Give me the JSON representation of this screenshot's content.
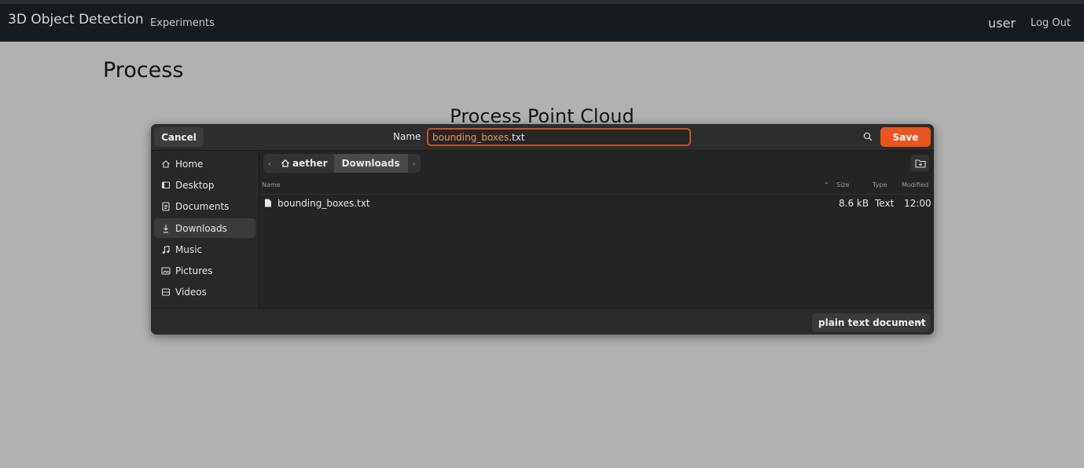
{
  "app": {
    "brand": "3D Object Detection",
    "nav_links": [
      "Experiments"
    ],
    "user": "user",
    "logout": "Log Out"
  },
  "page": {
    "title": "Process",
    "section_title": "Process Point Cloud"
  },
  "dialog": {
    "cancel_label": "Cancel",
    "name_label": "Name",
    "filename_stem": "bounding_boxes",
    "filename_ext": ".txt",
    "save_label": "Save",
    "sidebar": [
      {
        "label": "Home",
        "icon": "home-icon",
        "active": false
      },
      {
        "label": "Desktop",
        "icon": "desktop-icon",
        "active": false
      },
      {
        "label": "Documents",
        "icon": "document-icon",
        "active": false
      },
      {
        "label": "Downloads",
        "icon": "download-icon",
        "active": true
      },
      {
        "label": "Music",
        "icon": "music-icon",
        "active": false
      },
      {
        "label": "Pictures",
        "icon": "pictures-icon",
        "active": false
      },
      {
        "label": "Videos",
        "icon": "videos-icon",
        "active": false
      }
    ],
    "path": [
      "aether",
      "Downloads"
    ],
    "columns": {
      "name": "Name",
      "size": "Size",
      "type": "Type",
      "modified": "Modified"
    },
    "files": [
      {
        "name": "bounding_boxes.txt",
        "size": "8.6 kB",
        "type": "Text",
        "modified": "12:00"
      }
    ],
    "filter": "plain text document"
  },
  "colors": {
    "accent": "#e95420",
    "page_bg": "#b1b1b1",
    "navbar_bg": "#161b1f",
    "dialog_bg": "#242424"
  }
}
